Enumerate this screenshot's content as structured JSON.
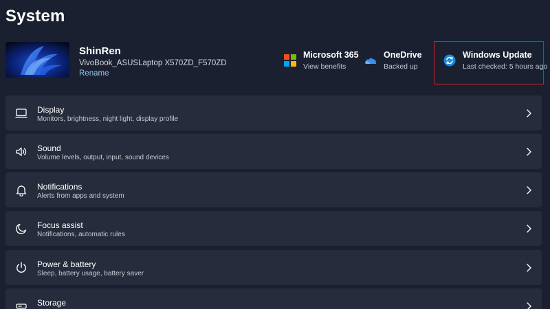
{
  "page": {
    "title": "System"
  },
  "device": {
    "name": "ShinRen",
    "model": "VivoBook_ASUSLaptop X570ZD_F570ZD",
    "rename_label": "Rename"
  },
  "quick_links": [
    {
      "title": "Microsoft 365",
      "subtitle": "View benefits",
      "icon": "microsoft-365-icon"
    },
    {
      "title": "OneDrive",
      "subtitle": "Backed up",
      "icon": "onedrive-icon"
    },
    {
      "title": "Windows Update",
      "subtitle": "Last checked: 5 hours ago",
      "icon": "windows-update-icon"
    }
  ],
  "settings": [
    {
      "title": "Display",
      "subtitle": "Monitors, brightness, night light, display profile",
      "icon": "display-icon"
    },
    {
      "title": "Sound",
      "subtitle": "Volume levels, output, input, sound devices",
      "icon": "speaker-icon"
    },
    {
      "title": "Notifications",
      "subtitle": "Alerts from apps and system",
      "icon": "bell-icon"
    },
    {
      "title": "Focus assist",
      "subtitle": "Notifications, automatic rules",
      "icon": "moon-icon"
    },
    {
      "title": "Power & battery",
      "subtitle": "Sleep, battery usage, battery saver",
      "icon": "power-icon"
    },
    {
      "title": "Storage",
      "subtitle": "",
      "icon": "storage-icon"
    }
  ],
  "colors": {
    "background": "#1b2030",
    "row_background": "#272c3c",
    "accent_link": "#8ec7ee",
    "highlight_border": "#d01f24"
  }
}
